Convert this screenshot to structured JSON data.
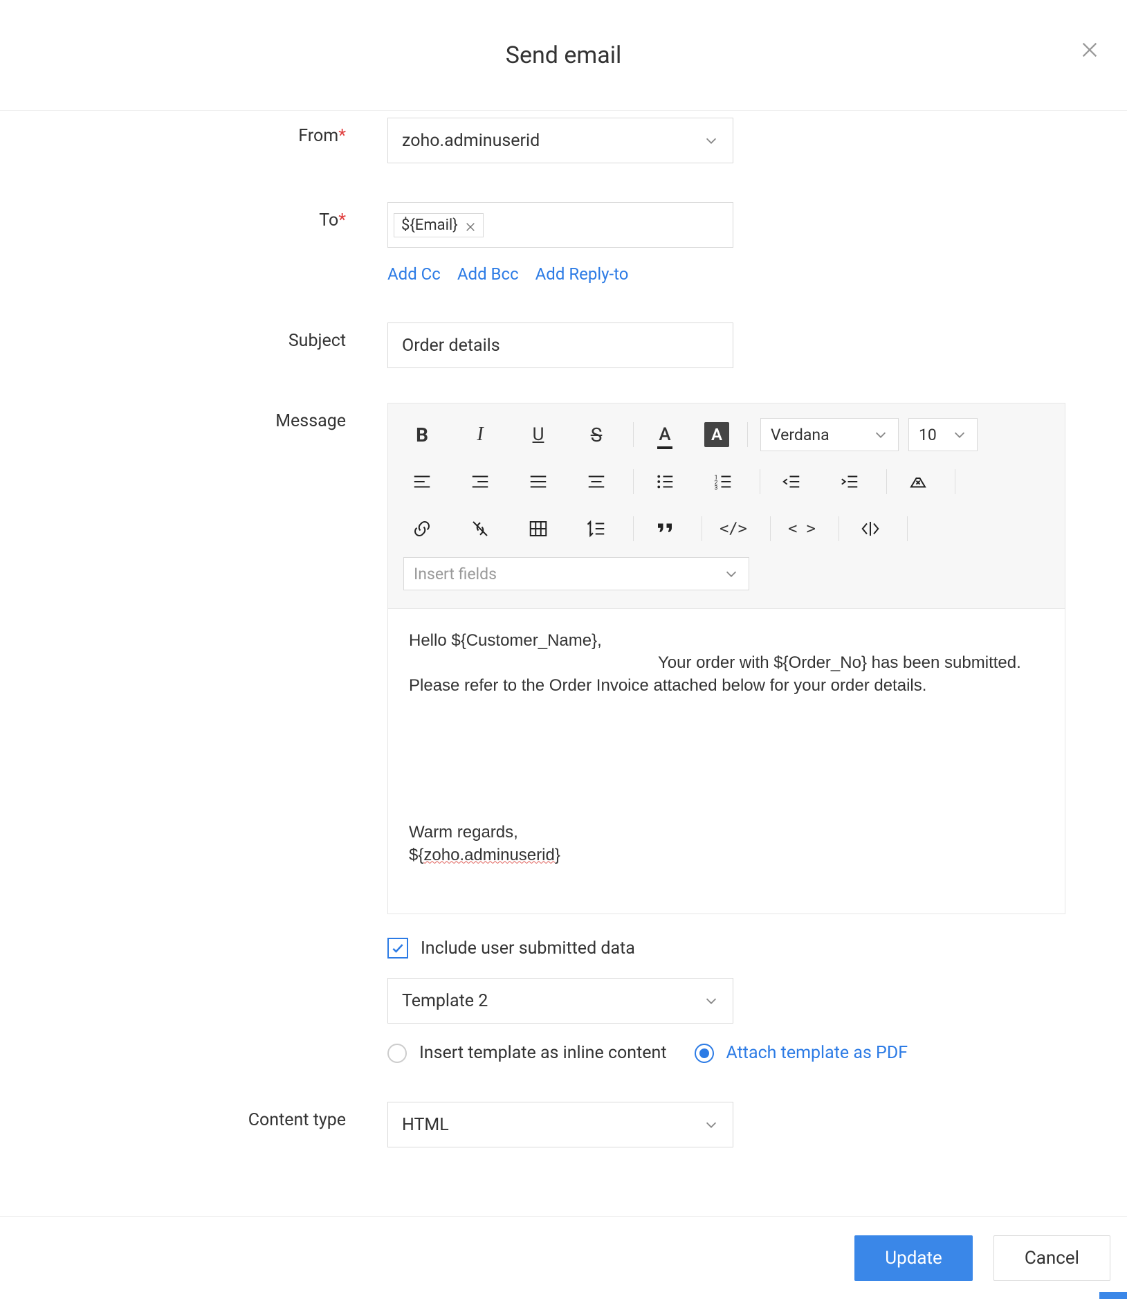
{
  "header": {
    "title": "Send email"
  },
  "labels": {
    "from": "From",
    "to": "To",
    "subject": "Subject",
    "message": "Message",
    "content_type": "Content type"
  },
  "from": {
    "value": "zoho.adminuserid"
  },
  "to": {
    "chip": "${Email}"
  },
  "links": {
    "add_cc": "Add Cc",
    "add_bcc": "Add Bcc",
    "add_reply_to": "Add Reply-to"
  },
  "subject": {
    "value": "Order details"
  },
  "toolbar": {
    "font_name": "Verdana",
    "font_size": "10",
    "insert_placeholder": "Insert fields"
  },
  "editor": {
    "line1": "Hello ${Customer_Name},",
    "line2_indent": "Your order with ${Order_No} has been submitted. Please refer to the Order Invoice attached below for your order details.",
    "regards1": "Warm regards,",
    "regards2_pre": "${",
    "regards2_wavy": "zoho.adminuserid",
    "regards2_post": "}"
  },
  "include_data": {
    "label": "Include user submitted data",
    "checked": true
  },
  "template_select": {
    "value": "Template 2"
  },
  "template_mode": {
    "inline_label": "Insert template as inline content",
    "pdf_label": "Attach template as PDF"
  },
  "content_type": {
    "value": "HTML"
  },
  "footer": {
    "update": "Update",
    "cancel": "Cancel"
  }
}
